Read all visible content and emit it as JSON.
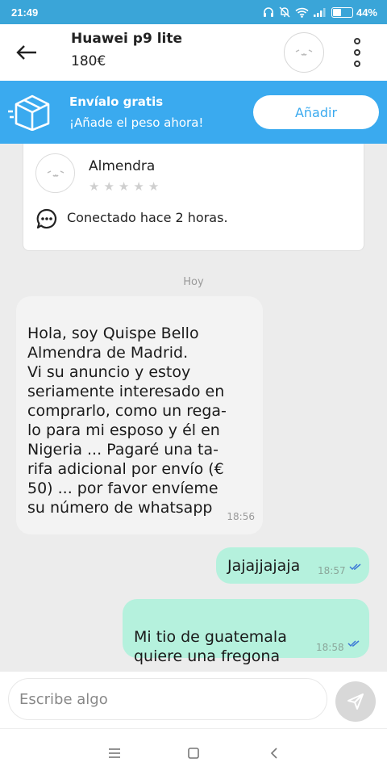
{
  "status_bar": {
    "time": "21:49",
    "battery": "44%",
    "battery_level": 0.44
  },
  "header": {
    "title": "Huawei p9 lite",
    "price": "180€"
  },
  "shipping": {
    "title": "Envíalo gratis",
    "subtitle": "¡Añade el peso ahora!",
    "button": "Añadir"
  },
  "seller": {
    "name": "Almendra",
    "rating_stars": 0,
    "status": "Conectado hace 2 horas."
  },
  "chat": {
    "date_label": "Hoy",
    "messages": [
      {
        "direction": "in",
        "text": "Hola, soy Quispe Bello\nAlmendra de Madrid.\nVi su anuncio y estoy\nseriamente interesado en\ncomprarlo, como un rega-\nlo para mi esposo y él en\nNigeria ... Pagaré una ta-\nrifa adicional por envío (€\n50) ... por favor envíeme\nsu número de whatsapp",
        "time": "18:56"
      },
      {
        "direction": "out",
        "text": "Jajajjajaja",
        "time": "18:57"
      },
      {
        "direction": "out",
        "text": "Mi tio de guatemala\nquiere una fregona",
        "time": "18:58"
      }
    ]
  },
  "composer": {
    "placeholder": "Escribe algo"
  },
  "colors": {
    "status_bar": "#3aa5d8",
    "banner": "#3aaaef",
    "outgoing_bubble": "#b5f1dd",
    "incoming_bubble": "#f3f3f3"
  }
}
